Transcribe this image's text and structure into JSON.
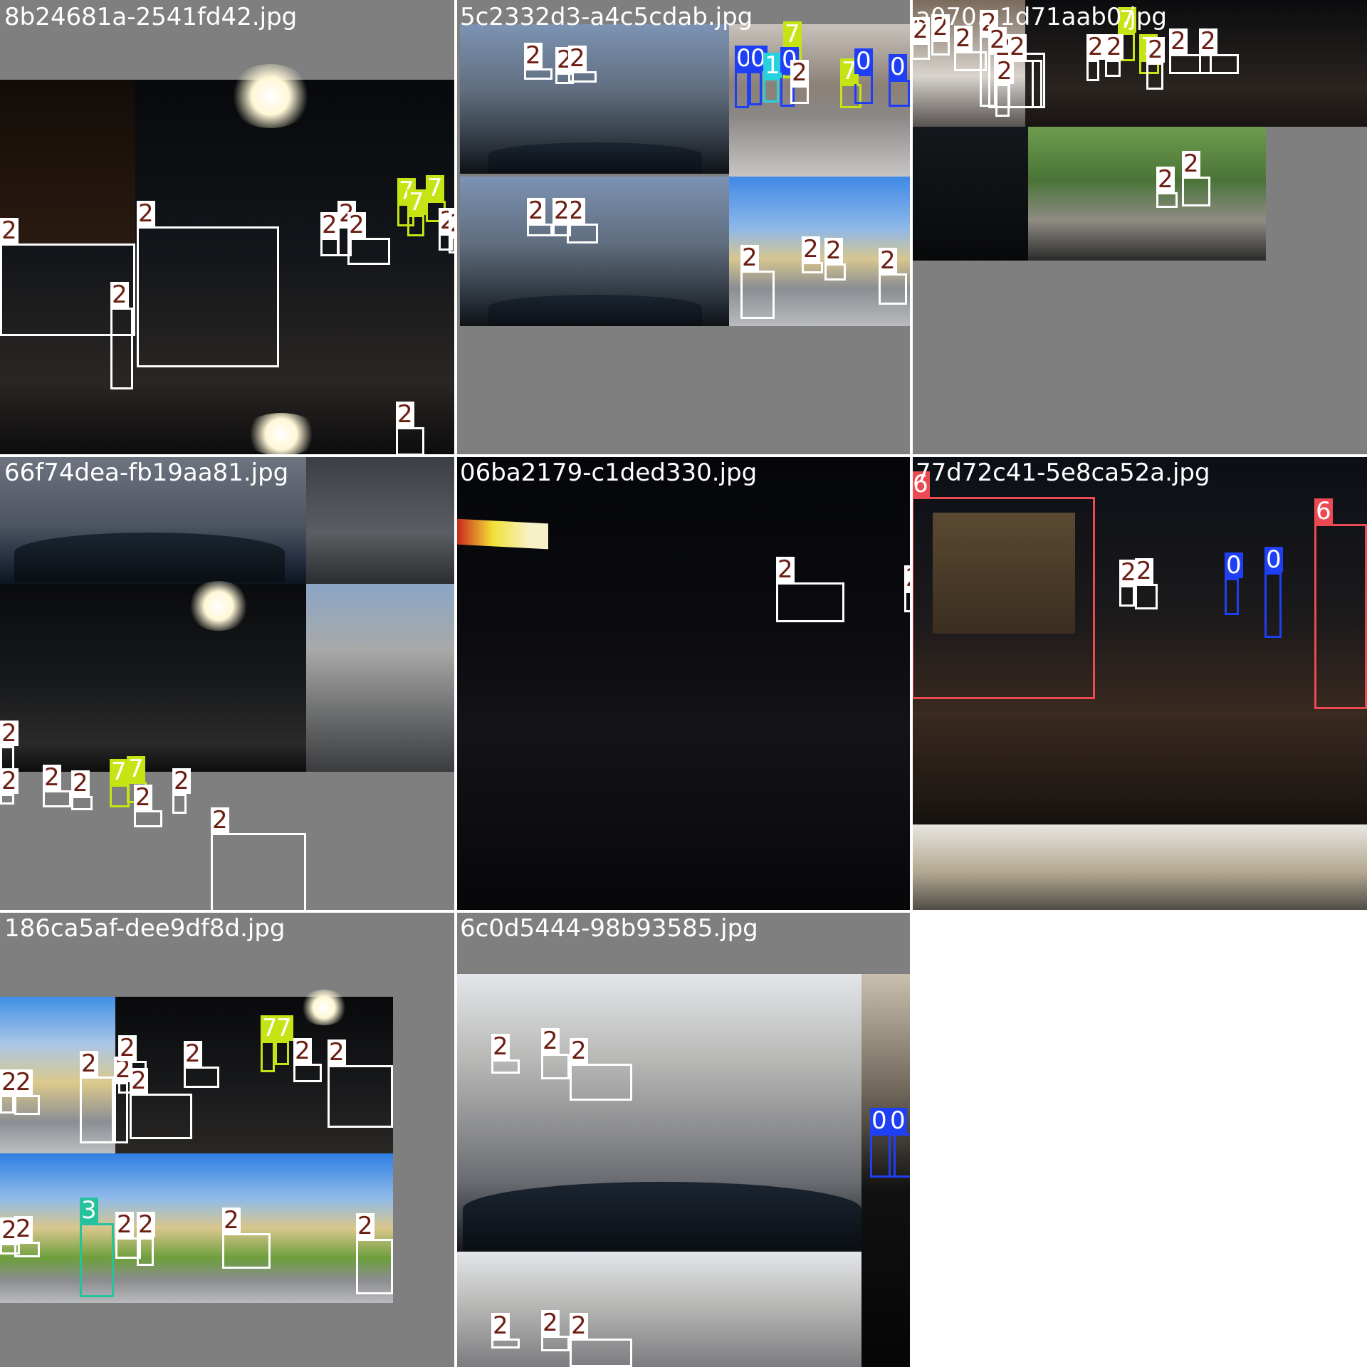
{
  "colors": {
    "class_0": "#1f3ff5",
    "class_1": "#27d2df",
    "class_2": "#ffffff",
    "class_3": "#25c29d",
    "class_6": "#ec4a52",
    "class_7": "#c6e414",
    "label_text_dark": "#6b1d12",
    "tile_background": "#7f7f7f"
  },
  "tiles": [
    {
      "title": "8b24681a-2541fd42.jpg",
      "boxes": [
        {
          "label": "2"
        },
        {
          "label": "2"
        },
        {
          "label": "2"
        },
        {
          "label": "2"
        },
        {
          "label": "2"
        },
        {
          "label": "2"
        },
        {
          "label": "2"
        },
        {
          "label": "7"
        },
        {
          "label": "7"
        },
        {
          "label": "7"
        },
        {
          "label": "2"
        },
        {
          "label": "2"
        }
      ]
    },
    {
      "title": "5c2332d3-a4c5cdab.jpg",
      "boxes": [
        {
          "label": "2"
        },
        {
          "label": "2"
        },
        {
          "label": "2"
        },
        {
          "label": "2"
        },
        {
          "label": "2"
        },
        {
          "label": "2"
        },
        {
          "label": "7"
        },
        {
          "label": "7"
        },
        {
          "label": "0"
        },
        {
          "label": "0"
        },
        {
          "label": "1"
        },
        {
          "label": "0"
        },
        {
          "label": "0"
        },
        {
          "label": "0"
        },
        {
          "label": "2"
        },
        {
          "label": "2"
        },
        {
          "label": "2"
        },
        {
          "label": "2"
        },
        {
          "label": "2"
        }
      ]
    },
    {
      "title": "a070...1d71aab0.jpg",
      "boxes": [
        {
          "label": "2"
        },
        {
          "label": "2"
        },
        {
          "label": "2"
        },
        {
          "label": "2"
        },
        {
          "label": "2"
        },
        {
          "label": "2"
        },
        {
          "label": "2"
        },
        {
          "label": "7"
        },
        {
          "label": "2"
        },
        {
          "label": "2"
        },
        {
          "label": "7"
        },
        {
          "label": "2"
        },
        {
          "label": "2"
        },
        {
          "label": "2"
        },
        {
          "label": "2"
        },
        {
          "label": "2"
        },
        {
          "label": "2"
        }
      ]
    },
    {
      "title": "66f74dea-fb19aa81.jpg",
      "boxes": [
        {
          "label": "2"
        },
        {
          "label": "2"
        },
        {
          "label": "2"
        },
        {
          "label": "2"
        },
        {
          "label": "7"
        },
        {
          "label": "7"
        },
        {
          "label": "2"
        },
        {
          "label": "2"
        },
        {
          "label": "2"
        }
      ]
    },
    {
      "title": "06ba2179-c1ded330.jpg",
      "boxes": [
        {
          "label": "2"
        },
        {
          "label": "2"
        }
      ]
    },
    {
      "title": "77d72c41-5e8ca52a.jpg",
      "boxes": [
        {
          "label": "6"
        },
        {
          "label": "6"
        },
        {
          "label": "2"
        },
        {
          "label": "2"
        },
        {
          "label": "0"
        },
        {
          "label": "0"
        }
      ]
    },
    {
      "title": "186ca5af-dee9df8d.jpg",
      "boxes": [
        {
          "label": "2"
        },
        {
          "label": "2"
        },
        {
          "label": "2"
        },
        {
          "label": "2"
        },
        {
          "label": "2"
        },
        {
          "label": "2"
        },
        {
          "label": "2"
        },
        {
          "label": "7"
        },
        {
          "label": "7"
        },
        {
          "label": "2"
        },
        {
          "label": "2"
        },
        {
          "label": "2"
        },
        {
          "label": "2"
        },
        {
          "label": "3"
        },
        {
          "label": "2"
        },
        {
          "label": "2"
        },
        {
          "label": "2"
        },
        {
          "label": "2"
        }
      ]
    },
    {
      "title": "6c0d5444-98b93585.jpg",
      "boxes": [
        {
          "label": "2"
        },
        {
          "label": "2"
        },
        {
          "label": "2"
        },
        {
          "label": "0"
        },
        {
          "label": "0"
        },
        {
          "label": "2"
        },
        {
          "label": "2"
        },
        {
          "label": "2"
        }
      ]
    }
  ]
}
